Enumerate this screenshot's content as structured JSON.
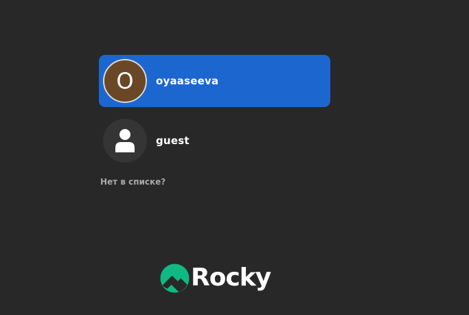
{
  "users": [
    {
      "name": "oyaaseeva",
      "avatar_initial": "O",
      "avatar_color": "#6a4726",
      "selected": true
    },
    {
      "name": "guest",
      "avatar_icon": "user-silhouette-icon",
      "selected": false
    }
  ],
  "not_listed_label": "Нет в списке?",
  "brand": {
    "name": "Rocky",
    "logo_icon": "rocky-linux-logo-icon",
    "accent_color": "#10b981"
  },
  "colors": {
    "background": "#282828",
    "selection": "#1c67cf"
  }
}
